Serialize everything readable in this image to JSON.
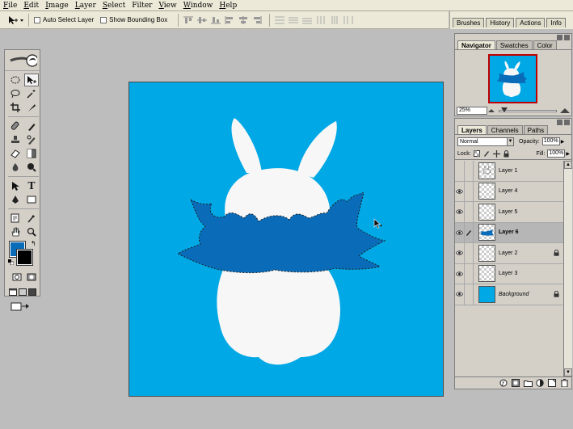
{
  "menu": [
    {
      "u": "F",
      "rest": "ile"
    },
    {
      "u": "E",
      "rest": "dit"
    },
    {
      "u": "I",
      "rest": "mage"
    },
    {
      "u": "L",
      "rest": "ayer"
    },
    {
      "u": "S",
      "rest": "elect"
    },
    {
      "u": "",
      "rest": "Filter"
    },
    {
      "u": "V",
      "rest": "iew"
    },
    {
      "u": "W",
      "rest": "indow"
    },
    {
      "u": "H",
      "rest": "elp"
    }
  ],
  "options": {
    "auto_select": "Auto Select Layer",
    "bounding_box": "Show Bounding Box"
  },
  "palette_well": [
    "Brushes",
    "History",
    "Actions",
    "Info"
  ],
  "navigator": {
    "tabs": [
      "Navigator",
      "Swatches",
      "Color"
    ],
    "zoom": "25%"
  },
  "layers": {
    "tabs": [
      "Layers",
      "Channels",
      "Paths"
    ],
    "blend_mode": "Normal",
    "opacity_label": "Opacity:",
    "opacity": "100%",
    "lock_label": "Lock:",
    "fill_label": "Fill:",
    "fill": "100%",
    "items": [
      {
        "name": "Layer 1",
        "visible": false,
        "selected": false,
        "locked": false,
        "thumb": "sketch"
      },
      {
        "name": "Layer 4",
        "visible": true,
        "selected": false,
        "locked": false,
        "thumb": "transparent"
      },
      {
        "name": "Layer 5",
        "visible": true,
        "selected": false,
        "locked": false,
        "thumb": "transparent"
      },
      {
        "name": "Layer 6",
        "visible": true,
        "selected": true,
        "locked": false,
        "thumb": "splash"
      },
      {
        "name": "Layer 2",
        "visible": true,
        "selected": false,
        "locked": true,
        "thumb": "transparent"
      },
      {
        "name": "Layer 3",
        "visible": true,
        "selected": false,
        "locked": false,
        "thumb": "transparent"
      },
      {
        "name": "Background",
        "visible": true,
        "selected": false,
        "locked": true,
        "thumb": "blue"
      }
    ]
  },
  "colors": {
    "canvas_bg": "#00a8e6",
    "bunny": "#f7f7f7",
    "splash": "#0a6cb9",
    "foreground": "#0a6cb9",
    "background": "#000000"
  }
}
